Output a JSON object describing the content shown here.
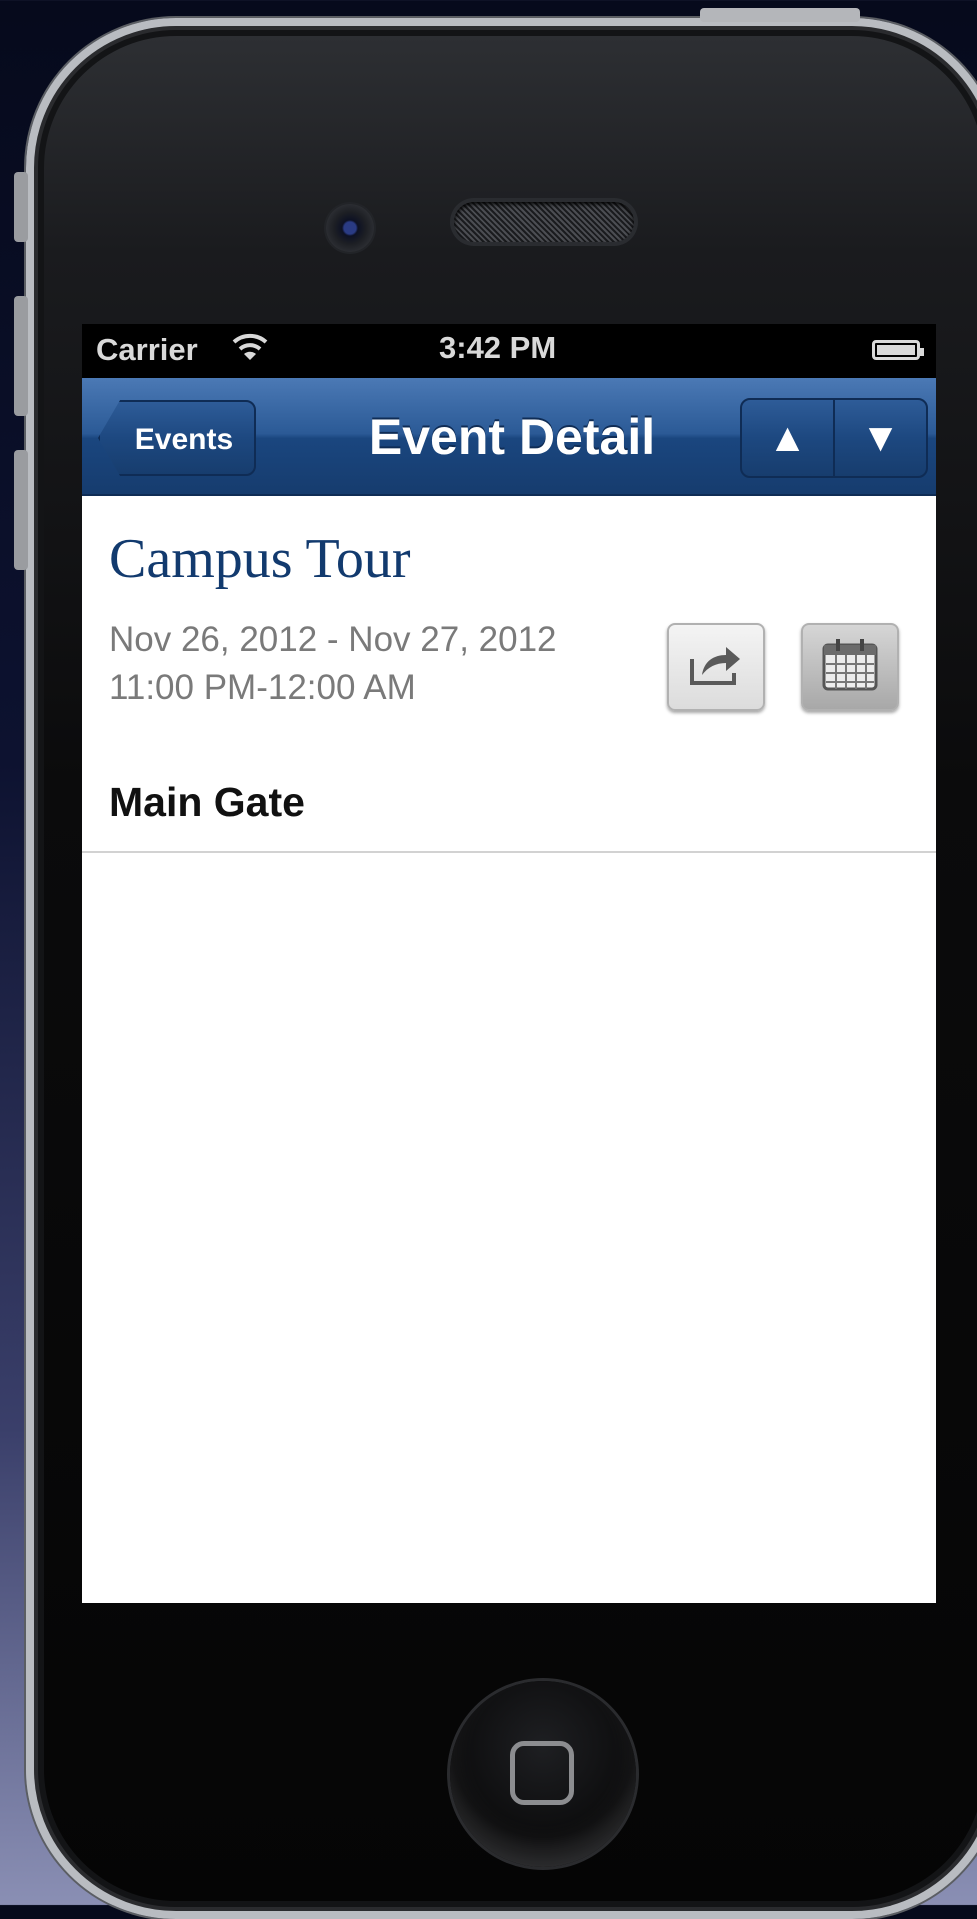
{
  "status_bar": {
    "carrier": "Carrier",
    "time": "3:42 PM"
  },
  "nav_bar": {
    "back_label": "Events",
    "title": "Event Detail",
    "up_arrow": "▲",
    "down_arrow": "▼"
  },
  "event": {
    "title": "Campus Tour",
    "date_range": "Nov 26, 2012 - Nov 27, 2012",
    "time_range": "11:00 PM-12:00 AM",
    "location": "Main Gate"
  },
  "icons": {
    "share": "share-icon",
    "calendar": "calendar-icon"
  },
  "colors": {
    "nav_bar": "#2b5a96",
    "title": "#123a6e",
    "date_text": "#7a7a7a"
  }
}
